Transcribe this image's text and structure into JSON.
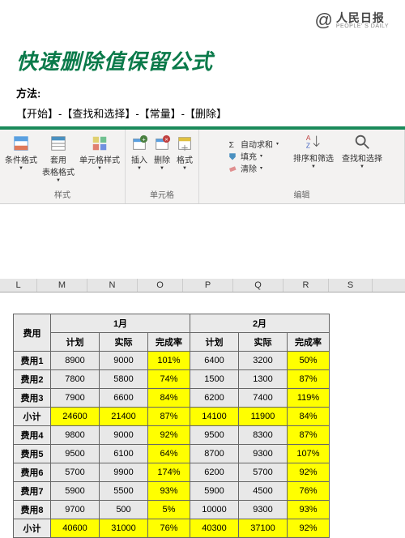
{
  "logo": {
    "cn": "人民日报",
    "en": "PEOPLE' S DAILY",
    "at": "@"
  },
  "title": "快速删除值保留公式",
  "method_label": "方法:",
  "method_steps": "【开始】-【查找和选择】-【常量】-【删除】",
  "ribbon": {
    "groups": {
      "styles": {
        "label": "样式",
        "conditional": "条件格式",
        "tablefmt": "套用\n表格格式",
        "cellstyle": "单元格样式"
      },
      "cells": {
        "label": "单元格",
        "insert": "插入",
        "delete": "删除",
        "format": "格式"
      },
      "edit": {
        "label": "编辑",
        "autosum": "自动求和",
        "fill": "填充",
        "clear": "清除",
        "sort": "排序和筛选",
        "find": "查找和选择"
      }
    }
  },
  "columns": [
    "L",
    "M",
    "N",
    "O",
    "P",
    "Q",
    "R",
    "S"
  ],
  "table": {
    "corner": "费用",
    "months": [
      "1月",
      "2月"
    ],
    "subheaders": [
      "计划",
      "实际",
      "完成率"
    ],
    "rows": [
      {
        "label": "费用1",
        "m1": {
          "plan": "8900",
          "act": "9000",
          "rate": "101%"
        },
        "m2": {
          "plan": "6400",
          "act": "3200",
          "rate": "50%"
        }
      },
      {
        "label": "费用2",
        "m1": {
          "plan": "7800",
          "act": "5800",
          "rate": "74%"
        },
        "m2": {
          "plan": "1500",
          "act": "1300",
          "rate": "87%"
        }
      },
      {
        "label": "费用3",
        "m1": {
          "plan": "7900",
          "act": "6600",
          "rate": "84%"
        },
        "m2": {
          "plan": "6200",
          "act": "7400",
          "rate": "119%"
        }
      },
      {
        "label": "小计",
        "m1": {
          "plan": "24600",
          "act": "21400",
          "rate": "87%"
        },
        "m2": {
          "plan": "14100",
          "act": "11900",
          "rate": "84%"
        },
        "subtotal": true
      },
      {
        "label": "费用4",
        "m1": {
          "plan": "9800",
          "act": "9000",
          "rate": "92%"
        },
        "m2": {
          "plan": "9500",
          "act": "8300",
          "rate": "87%"
        }
      },
      {
        "label": "费用5",
        "m1": {
          "plan": "9500",
          "act": "6100",
          "rate": "64%"
        },
        "m2": {
          "plan": "8700",
          "act": "9300",
          "rate": "107%"
        }
      },
      {
        "label": "费用6",
        "m1": {
          "plan": "5700",
          "act": "9900",
          "rate": "174%"
        },
        "m2": {
          "plan": "6200",
          "act": "5700",
          "rate": "92%"
        }
      },
      {
        "label": "费用7",
        "m1": {
          "plan": "5900",
          "act": "5500",
          "rate": "93%"
        },
        "m2": {
          "plan": "5900",
          "act": "4500",
          "rate": "76%"
        }
      },
      {
        "label": "费用8",
        "m1": {
          "plan": "9700",
          "act": "500",
          "rate": "5%"
        },
        "m2": {
          "plan": "10000",
          "act": "9300",
          "rate": "93%"
        }
      },
      {
        "label": "小计",
        "m1": {
          "plan": "40600",
          "act": "31000",
          "rate": "76%"
        },
        "m2": {
          "plan": "40300",
          "act": "37100",
          "rate": "92%"
        },
        "subtotal": true
      }
    ]
  }
}
